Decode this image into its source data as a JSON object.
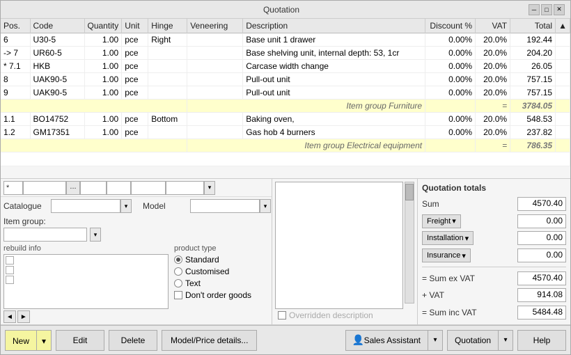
{
  "window": {
    "title": "Quotation",
    "minimize_label": "─",
    "restore_label": "□",
    "close_label": "✕"
  },
  "table": {
    "headers": {
      "pos": "Pos.",
      "code": "Code",
      "quantity": "Quantity",
      "unit": "Unit",
      "hinge": "Hinge",
      "veneering": "Veneering",
      "description": "Description",
      "discount": "Discount %",
      "vat": "VAT",
      "total": "Total"
    },
    "rows": [
      {
        "pos": "6",
        "code": "U30-5",
        "qty": "1.00",
        "unit": "pce",
        "hinge": "Right",
        "veneering": "",
        "description": "Base unit 1 drawer",
        "discount": "0.00%",
        "vat": "20.0%",
        "total": "192.44",
        "type": "data",
        "selected": false
      },
      {
        "pos": "-> 7",
        "code": "UR60-5",
        "qty": "1.00",
        "unit": "pce",
        "hinge": "",
        "veneering": "",
        "description": "Base shelving unit, internal depth: 53, 1cr",
        "discount": "0.00%",
        "vat": "20.0%",
        "total": "204.20",
        "type": "data",
        "selected": false
      },
      {
        "pos": "* 7.1",
        "code": "HKB",
        "qty": "1.00",
        "unit": "pce",
        "hinge": "",
        "veneering": "",
        "description": "Carcase width change",
        "discount": "0.00%",
        "vat": "20.0%",
        "total": "26.05",
        "type": "data",
        "selected": false
      },
      {
        "pos": "8",
        "code": "UAK90-5",
        "qty": "1.00",
        "unit": "pce",
        "hinge": "",
        "veneering": "",
        "description": "Pull-out unit",
        "discount": "0.00%",
        "vat": "20.0%",
        "total": "757.15",
        "type": "data",
        "selected": false
      },
      {
        "pos": "9",
        "code": "UAK90-5",
        "qty": "1.00",
        "unit": "pce",
        "hinge": "",
        "veneering": "",
        "description": "Pull-out unit",
        "discount": "0.00%",
        "vat": "20.0%",
        "total": "757.15",
        "type": "data",
        "selected": false
      },
      {
        "pos": "",
        "code": "",
        "qty": "",
        "unit": "",
        "hinge": "",
        "veneering": "Item group Furniture",
        "description": "",
        "discount": "",
        "vat": "=",
        "total": "3784.05",
        "type": "group",
        "selected": false
      },
      {
        "pos": "1.1",
        "code": "BO14752",
        "qty": "1.00",
        "unit": "pce",
        "hinge": "Bottom",
        "veneering": "",
        "description": "Baking oven,",
        "discount": "0.00%",
        "vat": "20.0%",
        "total": "548.53",
        "type": "data",
        "selected": false
      },
      {
        "pos": "1.2",
        "code": "GM17351",
        "qty": "1.00",
        "unit": "pce",
        "hinge": "",
        "veneering": "",
        "description": "Gas hob 4 burners",
        "discount": "0.00%",
        "vat": "20.0%",
        "total": "237.82",
        "type": "data",
        "selected": false
      },
      {
        "pos": "",
        "code": "",
        "qty": "",
        "unit": "",
        "hinge": "",
        "veneering": "Item group Electrical equipment",
        "description": "",
        "discount": "",
        "vat": "=",
        "total": "786.35",
        "type": "group",
        "selected": false
      }
    ]
  },
  "form": {
    "pos_value": "*",
    "pos_placeholder": "",
    "code_value": "",
    "dots_value": "...",
    "qty_value": "",
    "unit_value": "",
    "hinge_value": "",
    "veneering_value": "",
    "catalogue_label": "Catalogue",
    "catalogue_value": "",
    "model_label": "Model",
    "model_value": "",
    "model_btn": "...",
    "item_group_label": "Item group:",
    "item_group_value": "",
    "rebuild_label": "rebuild info",
    "product_type_label": "product type",
    "radio_standard": "Standard",
    "radio_customised": "Customised",
    "radio_text": "Text",
    "checkbox_dont_order": "Don't order goods",
    "overridden_label": "Overridden description"
  },
  "totals": {
    "title": "Quotation totals",
    "sum_label": "Sum",
    "sum_value": "4570.40",
    "freight_label": "Freight",
    "freight_value": "0.00",
    "installation_label": "Installation",
    "installation_value": "0.00",
    "insurance_label": "Insurance",
    "insurance_value": "0.00",
    "sum_ex_vat_label": "= Sum ex VAT",
    "sum_ex_vat_value": "4570.40",
    "vat_label": "+ VAT",
    "vat_value": "914.08",
    "sum_inc_vat_label": "= Sum inc VAT",
    "sum_inc_vat_value": "5484.48"
  },
  "toolbar": {
    "new_label": "New",
    "edit_label": "Edit",
    "delete_label": "Delete",
    "model_price_label": "Model/Price details...",
    "sales_assistant_label": "Sales Assistant",
    "quotation_label": "Quotation",
    "help_label": "Help",
    "arrow_down": "▾"
  }
}
